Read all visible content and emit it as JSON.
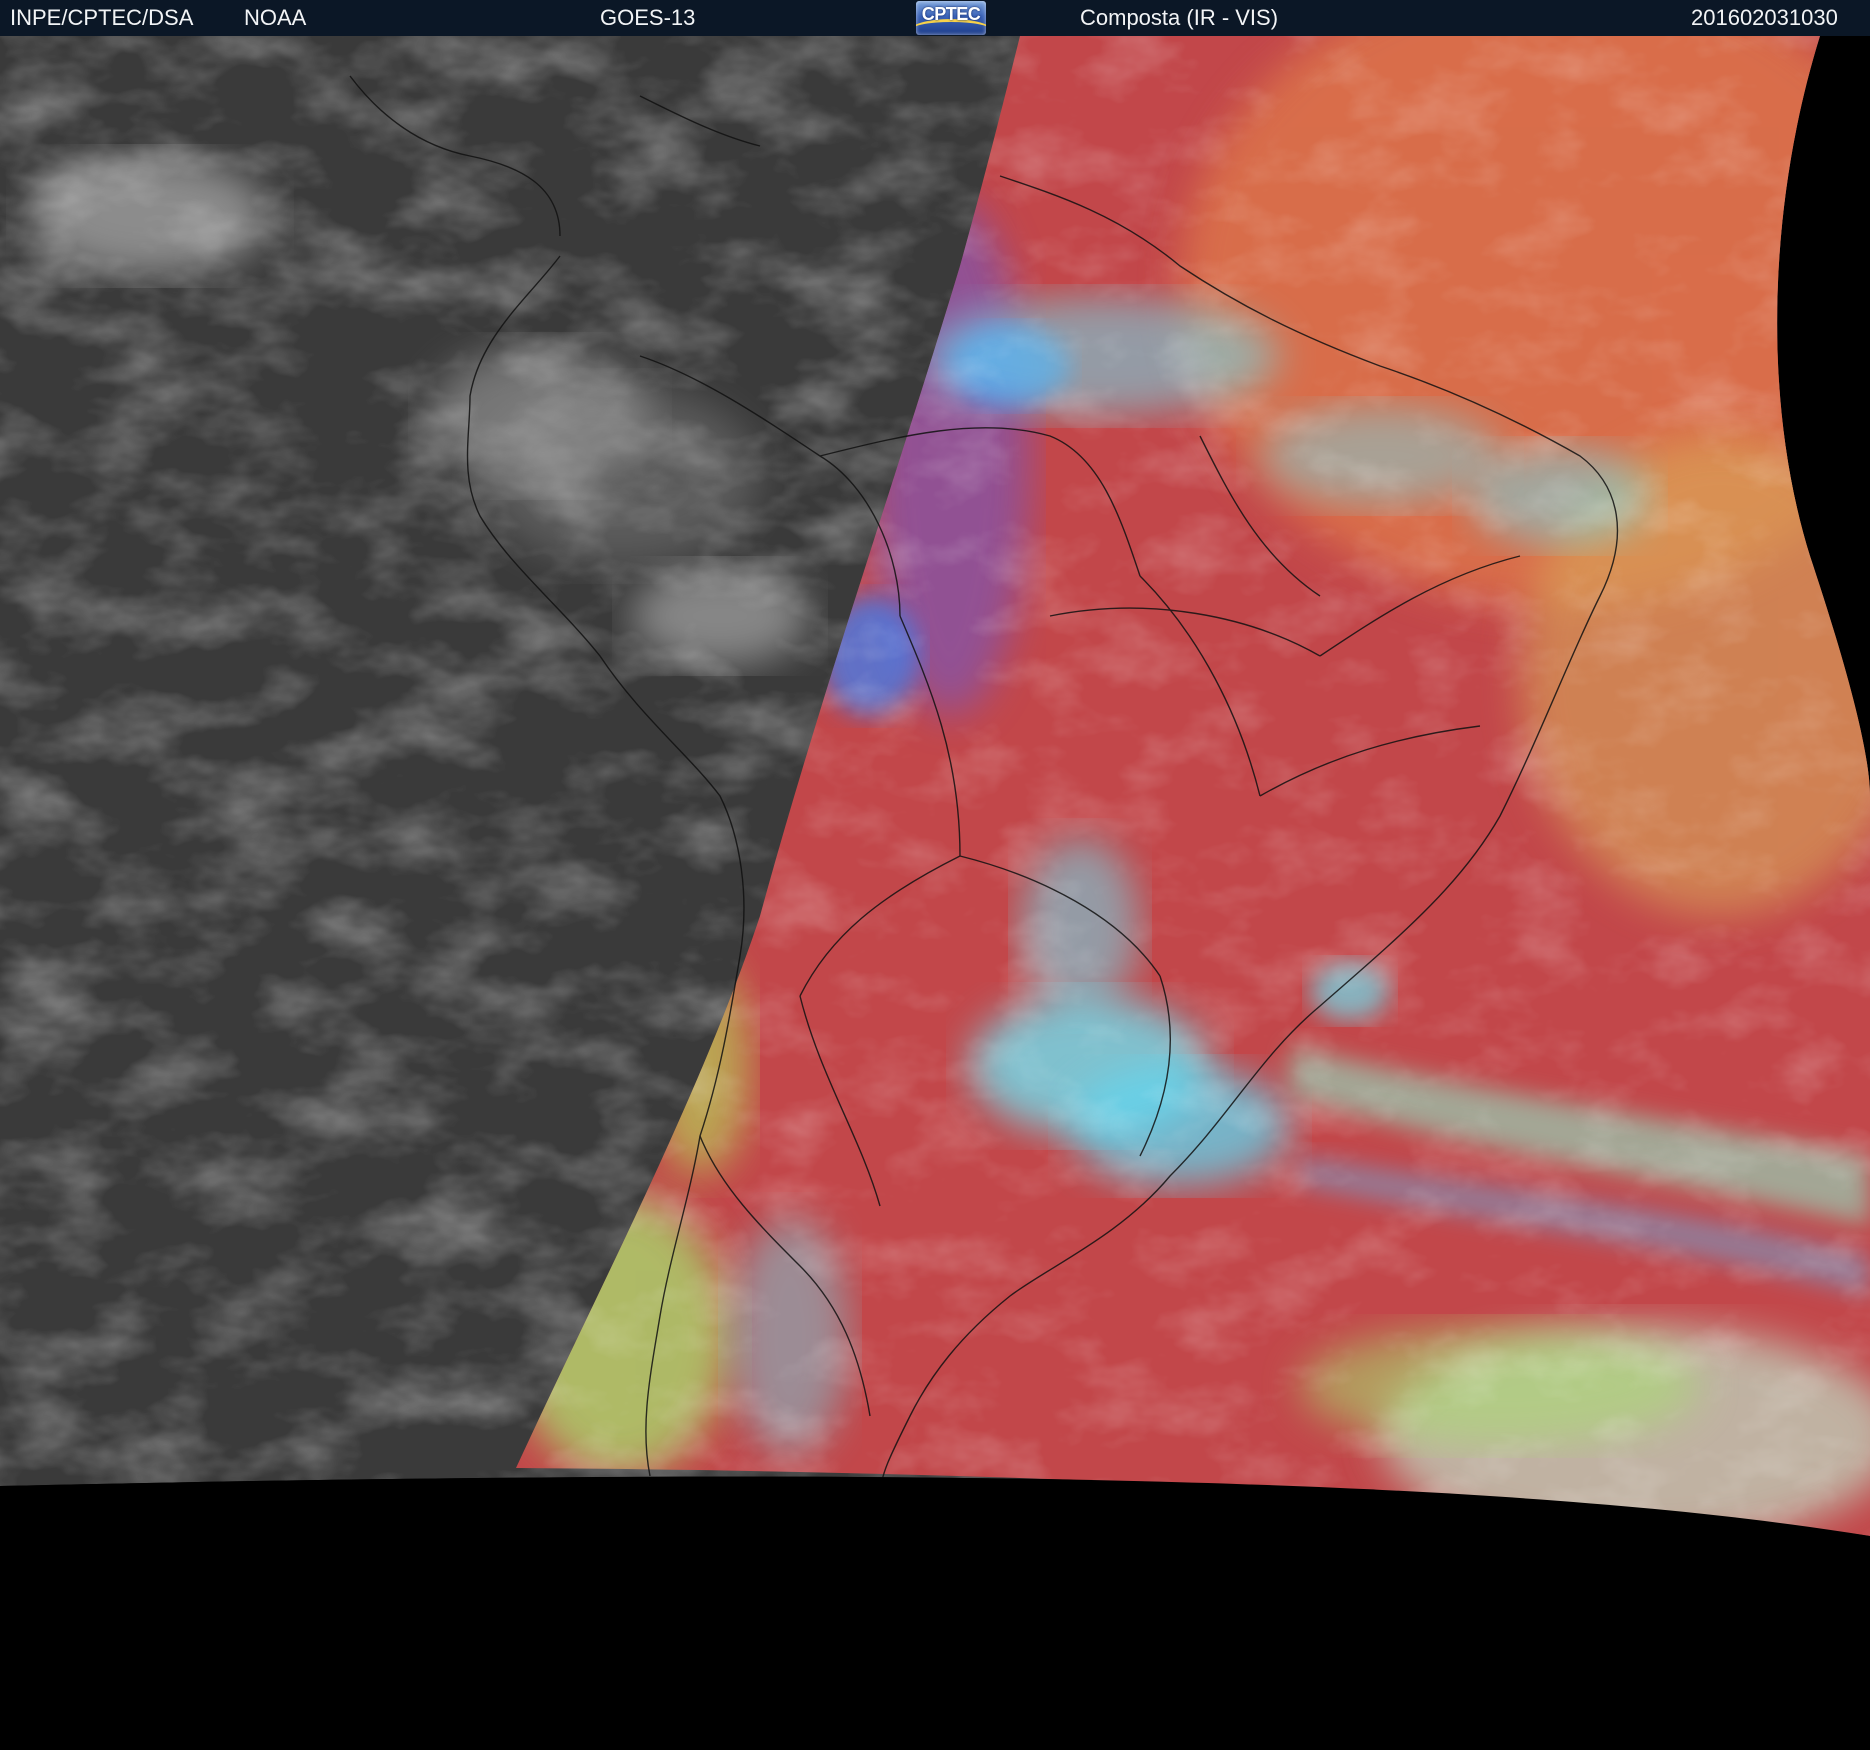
{
  "header": {
    "agency": "INPE/CPTEC/DSA",
    "source": "NOAA",
    "satellite": "GOES-13",
    "logo_text": "CPTEC",
    "product": "Composta (IR - VIS)",
    "timestamp": "201602031030"
  },
  "colors": {
    "header_background": "#0b1726",
    "header_text": "#f2f4f6",
    "night_ir_gray": "#3a3a3a",
    "day_composite_red": "#c2474a",
    "cloud_cyan": "#6fe0f0",
    "cloud_blue": "#3f7ff0",
    "cloud_green": "#a8e070",
    "ocean_orange": "#e07a4c",
    "space_black": "#000000"
  }
}
